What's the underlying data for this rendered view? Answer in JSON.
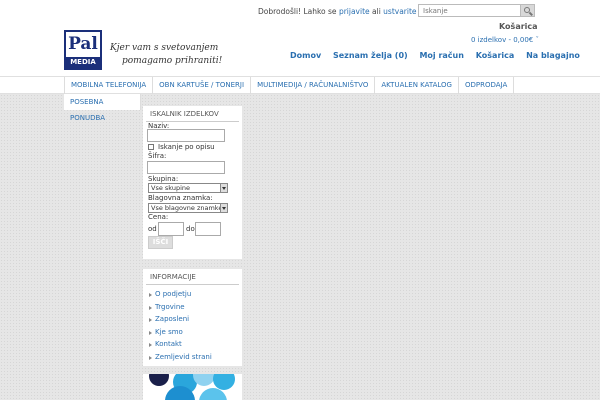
{
  "header": {
    "welcome_prefix": "Dobrodošli! Lahko se",
    "login_link": "prijavite",
    "welcome_mid": "ali",
    "register_link": "ustvarite račun",
    "welcome_suffix": ".",
    "search_placeholder": "Iskanje",
    "logo_top": "Pal",
    "logo_bottom": "MEDIA",
    "slogan_line1": "Kjer vam s svetovanjem",
    "slogan_line2": "pomagamo prihraniti!",
    "cart_title": "Košarica",
    "cart_summary": "0 izdelkov - 0,00€"
  },
  "top_nav": [
    "Domov",
    "Seznam želja (0)",
    "Moj račun",
    "Košarica",
    "Na blagajno"
  ],
  "main_nav": [
    "MOBILNA TELEFONIJA",
    "OBN KARTUŠE / TONERJI",
    "MULTIMEDIJA / RAČUNALNIŠTVO",
    "AKTUALEN KATALOG",
    "ODPRODAJA"
  ],
  "sub_nav": [
    "POSEBNA PONUDBA"
  ],
  "search_panel": {
    "title": "ISKALNIK IZDELKOV",
    "name_label": "Naziv:",
    "desc_checkbox_label": "Iskanje po opisu",
    "code_label": "Šifra:",
    "group_label": "Skupina:",
    "group_value": "Vse skupine",
    "brand_label": "Blagovna znamka:",
    "brand_value": "Vse blagovne znamke",
    "price_label": "Cena:",
    "from_label": "od",
    "to_label": "do",
    "search_button": "IŠČI"
  },
  "info_panel": {
    "title": "INFORMACIJE",
    "items": [
      "O podjetju",
      "Trgovine",
      "Zaposleni",
      "Kje smo",
      "Kontakt",
      "Zemljevid strani"
    ]
  },
  "colors": {
    "link": "#2a6fb0",
    "logo": "#1b2f7a",
    "background": "#e6e6e6"
  }
}
